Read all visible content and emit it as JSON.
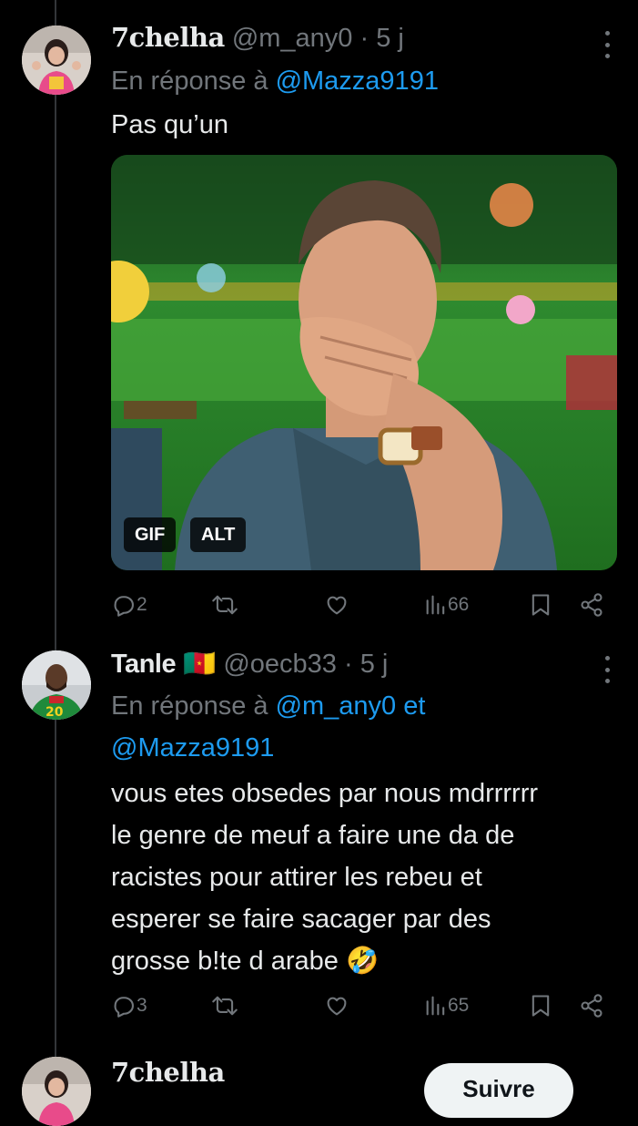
{
  "tweets": [
    {
      "name": "7chelha",
      "handle": "@m_any0",
      "sep": " · ",
      "time": "5 j",
      "reply_prefix": "En réponse à ",
      "reply_mentions": "@Mazza9191",
      "text": "Pas qu’un",
      "media_badges": [
        "GIF",
        "ALT"
      ],
      "stats": {
        "replies": "2",
        "retweets": "",
        "likes": "",
        "views": "66"
      }
    },
    {
      "name": "Tanle",
      "flag": "🇨🇲",
      "handle": "@oecb33",
      "sep": " · ",
      "time": "5 j",
      "reply_prefix": "En réponse à ",
      "reply_mention_1": "@m_any0",
      "reply_and": " et",
      "reply_mention_2": "@Mazza9191",
      "text_lines": [
        "vous etes obsedes par nous mdrrrrrr",
        "le genre de meuf a faire une da de",
        "racistes pour attirer les rebeu et",
        "esperer se faire sacager par des",
        "grosse b!te d arabe 🤣"
      ],
      "stats": {
        "replies": "3",
        "retweets": "",
        "likes": "",
        "views": "65"
      }
    },
    {
      "name": "7chelha",
      "follow_label": "Suivre"
    }
  ]
}
